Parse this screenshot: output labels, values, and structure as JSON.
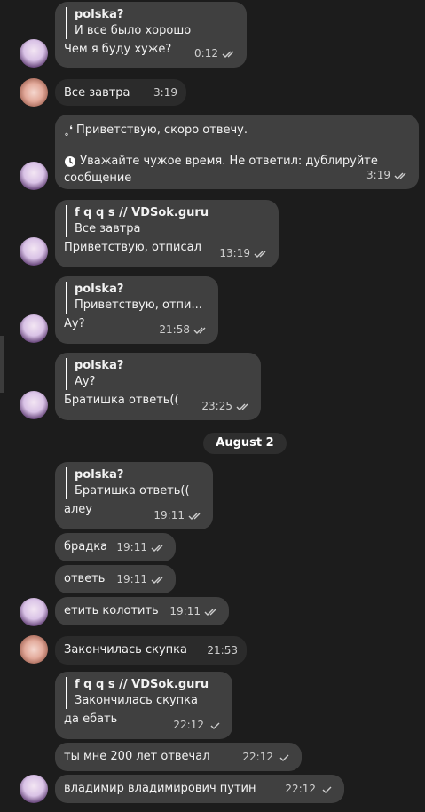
{
  "messages": [
    {
      "reply": {
        "name": "polska?",
        "text": "И все было хорошо"
      },
      "text": "Чем я буду хуже?",
      "time": "0:12",
      "status": "read"
    },
    {
      "text": "Все завтра",
      "time": "3:19",
      "status": "none"
    },
    {
      "lines": [
        "Приветствую, скоро отвечу.",
        "Уважайте чужое время. Не ответил: дублируйте",
        "сообщение"
      ],
      "time": "3:19",
      "status": "read"
    },
    {
      "reply": {
        "name": "f q q s // VDSok.guru",
        "text": "Все завтра"
      },
      "text": "Приветствую, отписал",
      "time": "13:19",
      "status": "read"
    },
    {
      "reply": {
        "name": "polska?",
        "text": "Приветствую, отпи..."
      },
      "text": "Ау?",
      "time": "21:58",
      "status": "read"
    },
    {
      "reply": {
        "name": "polska?",
        "text": "Ау?"
      },
      "text": "Братишка ответь((",
      "time": "23:25",
      "status": "read"
    },
    {
      "reply": {
        "name": "polska?",
        "text": "Братишка ответь(("
      },
      "text": "алеу",
      "time": "19:11",
      "status": "read"
    },
    {
      "text": "брадка",
      "time": "19:11",
      "status": "read"
    },
    {
      "text": "ответь",
      "time": "19:11",
      "status": "read"
    },
    {
      "text": "етить колотить",
      "time": "19:11",
      "status": "read"
    },
    {
      "text": "Закончилась скупка",
      "time": "21:53",
      "status": "none"
    },
    {
      "reply": {
        "name": "f q q s // VDSok.guru",
        "text": "Закончилась скупка"
      },
      "text": "да ебать",
      "time": "22:12",
      "status": "sent"
    },
    {
      "text": "ты мне 200 лет отвечал",
      "time": "22:12",
      "status": "sent"
    },
    {
      "text": "владимир владимирович путин",
      "time": "22:12",
      "status": "sent"
    }
  ],
  "date_separator": "August 2",
  "icons": {
    "read": "double-check-icon",
    "sent": "single-check-icon",
    "clock": "clock-icon"
  },
  "colors": {
    "background": "#1c1c1c",
    "bubble_self": "#404040",
    "bubble_other": "#2b2b2b",
    "text": "#f2f2f2",
    "meta": "#cfcfcf"
  }
}
